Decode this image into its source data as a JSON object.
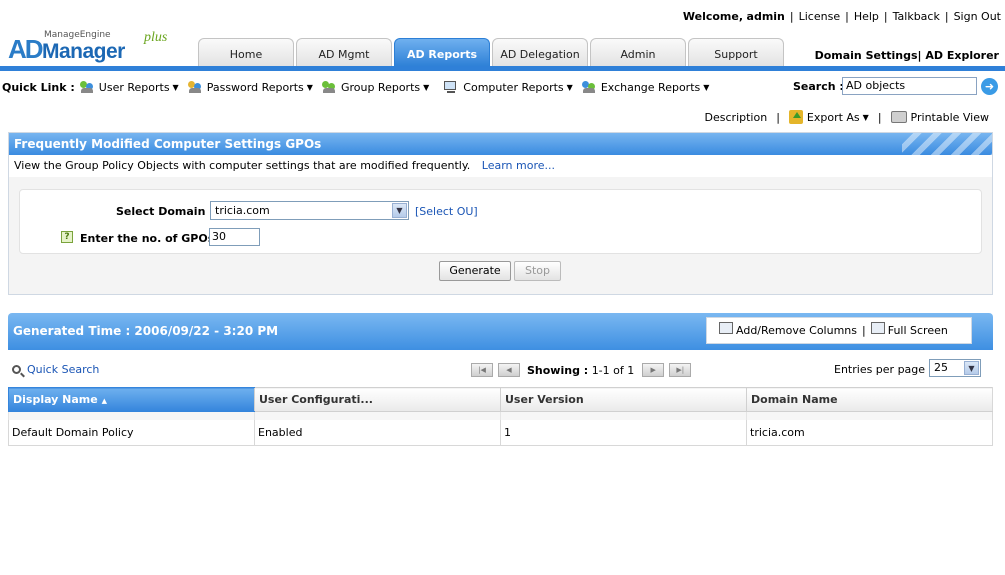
{
  "app": {
    "logo_brand": "ManageEngine",
    "logo_ad": "AD",
    "logo_manager": "Manager",
    "logo_plus": "plus"
  },
  "header": {
    "welcome_label": "Welcome,",
    "user": "admin",
    "links": [
      "License",
      "Help",
      "Talkback",
      "Sign Out"
    ],
    "tabs": [
      {
        "label": "Home"
      },
      {
        "label": "AD Mgmt"
      },
      {
        "label": "AD Reports"
      },
      {
        "label": "AD Delegation"
      },
      {
        "label": "Admin"
      },
      {
        "label": "Support"
      }
    ],
    "domain_settings": "Domain Settings",
    "ad_explorer": "AD Explorer"
  },
  "quick_links": {
    "label": "Quick Link :",
    "items": [
      {
        "label": "User Reports",
        "icon": "users-icon"
      },
      {
        "label": "Password Reports",
        "icon": "users-key-icon"
      },
      {
        "label": "Group Reports",
        "icon": "group-icon"
      },
      {
        "label": "Computer Reports",
        "icon": "computer-icon"
      },
      {
        "label": "Exchange Reports",
        "icon": "exchange-icon"
      }
    ]
  },
  "search": {
    "label": "Search :",
    "value": "AD objects"
  },
  "actions": {
    "description": "Description",
    "export": "Export As",
    "printable": "Printable View"
  },
  "report": {
    "title": "Frequently Modified Computer Settings GPOs",
    "description": "View the Group Policy Objects with computer settings that are modified frequently.",
    "learn_more": "Learn more...",
    "domain_label": "Select Domain :",
    "domain_value": "tricia.com",
    "select_ou": "[Select OU]",
    "gpos_label": "Enter the no. of GPOs :",
    "gpos_value": "30",
    "generate": "Generate",
    "stop": "Stop"
  },
  "results": {
    "generated": "Generated Time : 2006/09/22 - 3:20 PM",
    "add_remove_columns": "Add/Remove Columns",
    "full_screen": "Full Screen",
    "quick_search": "Quick Search",
    "showing_label": "Showing :",
    "showing_value": "1-1 of 1",
    "entries_label": "Entries per page",
    "entries_value": "25",
    "columns": [
      "Display Name",
      "User Configurati...",
      "User Version",
      "Domain Name"
    ],
    "rows": [
      [
        "Default Domain Policy",
        "Enabled",
        "1",
        "tricia.com"
      ]
    ]
  }
}
